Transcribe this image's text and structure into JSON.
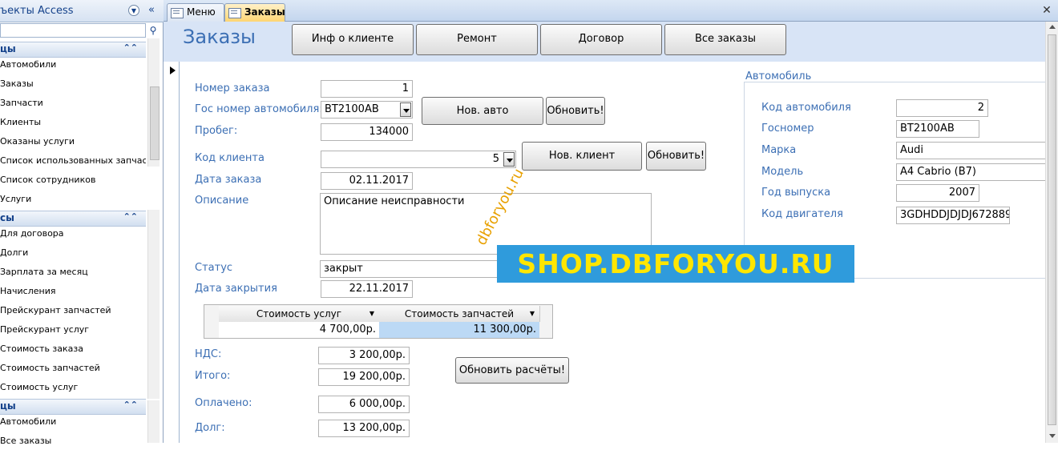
{
  "nav": {
    "title": "ъекты Access",
    "groups": [
      {
        "label": "цы",
        "items": [
          "Автомобили",
          "Заказы",
          "Запчасти",
          "Клиенты",
          "Оказаны услуги",
          "Список использованных запчас...",
          "Список сотрудников",
          "Услуги"
        ]
      },
      {
        "label": "сы",
        "items": [
          "Для договора",
          "Долги",
          "Зарплата за месяц",
          "Начисления",
          "Прейскурант запчастей",
          "Прейскурант услуг",
          "Стоимость заказа",
          "Стоимость запчастей",
          "Стоимость услуг"
        ]
      },
      {
        "label": "цы",
        "items": [
          "Автомобили",
          "Все заказы"
        ]
      }
    ]
  },
  "tabs": {
    "menu": "Меню",
    "orders": "Заказы"
  },
  "header": {
    "title": "Заказы",
    "buttons": [
      "Инф о клиенте",
      "Ремонт",
      "Договор",
      "Все заказы"
    ]
  },
  "form": {
    "order_no_label": "Номер заказа",
    "order_no": "1",
    "plate_label": "Гос номер автомобиля:",
    "plate": "ВТ2100АВ",
    "new_car_btn": "Нов. авто",
    "refresh_btn": "Обновить!",
    "mileage_label": "Пробег:",
    "mileage": "134000",
    "client_label": "Код клиента",
    "client": "5",
    "new_client_btn": "Нов. клиент",
    "refresh_btn2": "Обновить!",
    "date_label": "Дата заказа",
    "date": "02.11.2017",
    "desc_label": "Описание",
    "desc": "Описание неисправности",
    "status_label": "Статус",
    "status": "закрыт",
    "close_label": "Дата закрытия",
    "close_date": "22.11.2017",
    "vat_label": "НДС:",
    "vat": "3 200,00р.",
    "total_label": "Итого:",
    "total": "19 200,00р.",
    "paid_label": "Оплачено:",
    "paid": "6 000,00р.",
    "debt_label": "Долг:",
    "debt": "13 200,00р.",
    "recalc_btn": "Обновить расчёты!"
  },
  "subform": {
    "col1": "Стоимость услуг",
    "col2": "Стоимость запчастей",
    "val1": "4 700,00р.",
    "val2": "11 300,00р."
  },
  "car": {
    "group_label": "Автомобиль",
    "code_label": "Код автомобиля",
    "code": "2",
    "plate_label": "Госномер",
    "plate": "ВТ2100АВ",
    "make_label": "Марка",
    "make": "Audi",
    "model_label": "Модель",
    "model": "A4 Cabrio (B7)",
    "year_label": "Год выпуска",
    "year": "2007",
    "engine_label": "Код двигателя",
    "engine": "3GDHDDJDJDJ672889"
  },
  "watermark": {
    "banner": "SHOP.DBFORYOU.RU",
    "diagonal": "dbforyou.ru"
  },
  "colors": {
    "label": "#3c6fb4",
    "header_bg": "#d8e4f6",
    "active_tab": "#ffd46e",
    "banner_bg": "#2f9bdc",
    "banner_text": "#ffe600"
  }
}
